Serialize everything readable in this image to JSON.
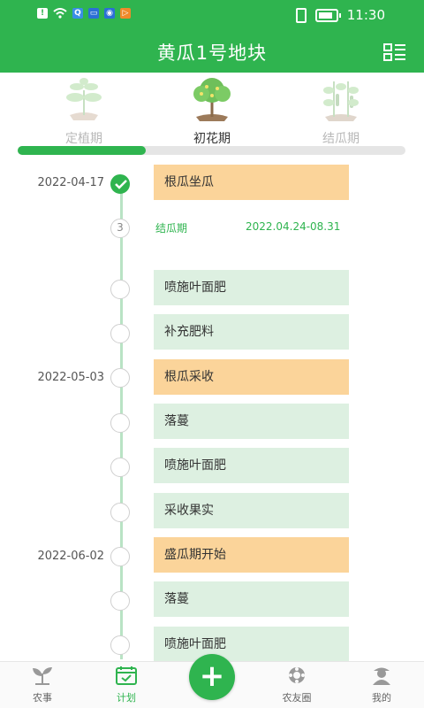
{
  "status_bar": {
    "time": "11:30"
  },
  "header": {
    "title": "黄瓜1号地块"
  },
  "stages": [
    {
      "label": "定植期",
      "active": false
    },
    {
      "label": "初花期",
      "active": true
    },
    {
      "label": "结瓜期",
      "active": false
    }
  ],
  "progress": {
    "fraction": 0.33
  },
  "period": {
    "number": "3",
    "name": "结瓜期",
    "range": "2022.04.24-08.31"
  },
  "timeline": [
    {
      "date": "2022-04-17",
      "task": "根瓜坐瓜",
      "highlight": true,
      "done": true
    },
    {
      "date": "",
      "task": "喷施叶面肥",
      "highlight": false,
      "done": false
    },
    {
      "date": "",
      "task": "补充肥料",
      "highlight": false,
      "done": false
    },
    {
      "date": "2022-05-03",
      "task": "根瓜采收",
      "highlight": true,
      "done": false
    },
    {
      "date": "",
      "task": "落蔓",
      "highlight": false,
      "done": false
    },
    {
      "date": "",
      "task": "喷施叶面肥",
      "highlight": false,
      "done": false
    },
    {
      "date": "",
      "task": "采收果实",
      "highlight": false,
      "done": false
    },
    {
      "date": "2022-06-02",
      "task": "盛瓜期开始",
      "highlight": true,
      "done": false
    },
    {
      "date": "",
      "task": "落蔓",
      "highlight": false,
      "done": false
    },
    {
      "date": "",
      "task": "喷施叶面肥",
      "highlight": false,
      "done": false
    }
  ],
  "bottom_nav": [
    {
      "label": "农事",
      "icon": "sprout-icon"
    },
    {
      "label": "计划",
      "icon": "calendar-check-icon",
      "active": true
    },
    {
      "label": "",
      "icon": "plus-icon"
    },
    {
      "label": "农友圈",
      "icon": "flower-icon"
    },
    {
      "label": "我的",
      "icon": "user-icon"
    }
  ],
  "colors": {
    "primary": "#2fb44f",
    "highlight_card": "#fbd49a",
    "normal_card": "#ddf0e1"
  }
}
